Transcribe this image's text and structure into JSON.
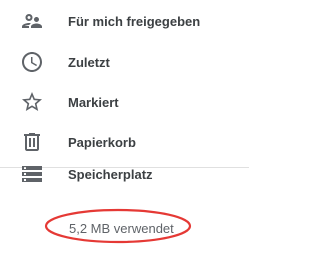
{
  "sidebar": {
    "items": [
      {
        "label": "Für mich freigegeben",
        "icon": "people-icon"
      },
      {
        "label": "Zuletzt",
        "icon": "clock-icon"
      },
      {
        "label": "Markiert",
        "icon": "star-icon"
      },
      {
        "label": "Papierkorb",
        "icon": "trash-icon"
      }
    ],
    "storage": {
      "label": "Speicherplatz",
      "icon": "storage-icon",
      "usage": "5,2 MB verwendet"
    }
  },
  "colors": {
    "icon": "#5f6368",
    "label": "#3c4043",
    "annotation": "#e53935"
  }
}
